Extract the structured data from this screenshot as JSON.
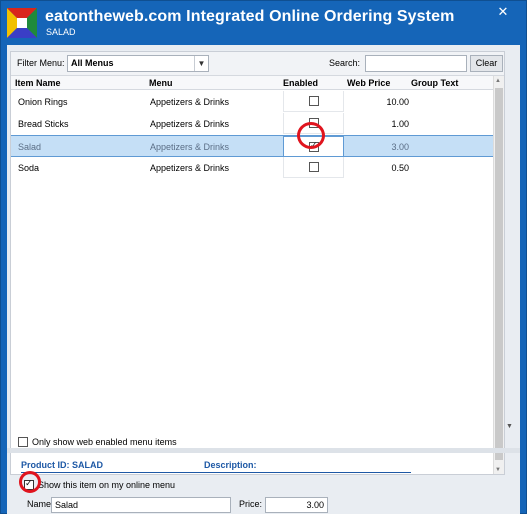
{
  "window": {
    "title": "eatontheweb.com Integrated Online Ordering System",
    "subtitle": "SALAD",
    "close_icon": "close-icon",
    "colors": {
      "titlebar": "#1565b8",
      "selection": "#c5dff6",
      "annotation": "#e0141e",
      "detail_accent": "#1d58a5"
    }
  },
  "filter": {
    "label": "Filter Menu:",
    "selected": "All Menus",
    "search_label": "Search:",
    "search_value": "",
    "clear_label": "Clear"
  },
  "grid": {
    "columns": [
      "Item Name",
      "Menu",
      "Enabled",
      "Web Price",
      "Group Text"
    ],
    "rows": [
      {
        "name": "Onion Rings",
        "menu": "Appetizers & Drinks",
        "enabled": false,
        "price": "10.00"
      },
      {
        "name": "Bread Sticks",
        "menu": "Appetizers & Drinks",
        "enabled": false,
        "price": "1.00"
      },
      {
        "name": "Salad",
        "menu": "Appetizers & Drinks",
        "enabled": true,
        "price": "3.00",
        "selected": true
      },
      {
        "name": "Soda",
        "menu": "Appetizers & Drinks",
        "enabled": false,
        "price": "0.50"
      }
    ]
  },
  "only_web_enabled": {
    "label": "Only show web enabled menu items",
    "checked": false
  },
  "detail": {
    "product_id_label": "Product ID: SALAD",
    "description_label": "Description:",
    "show_label": "Show this item on my online menu",
    "show_checked": true,
    "name_label": "Name:",
    "name_value": "Salad",
    "price_label": "Price:",
    "price_value": "3.00"
  }
}
